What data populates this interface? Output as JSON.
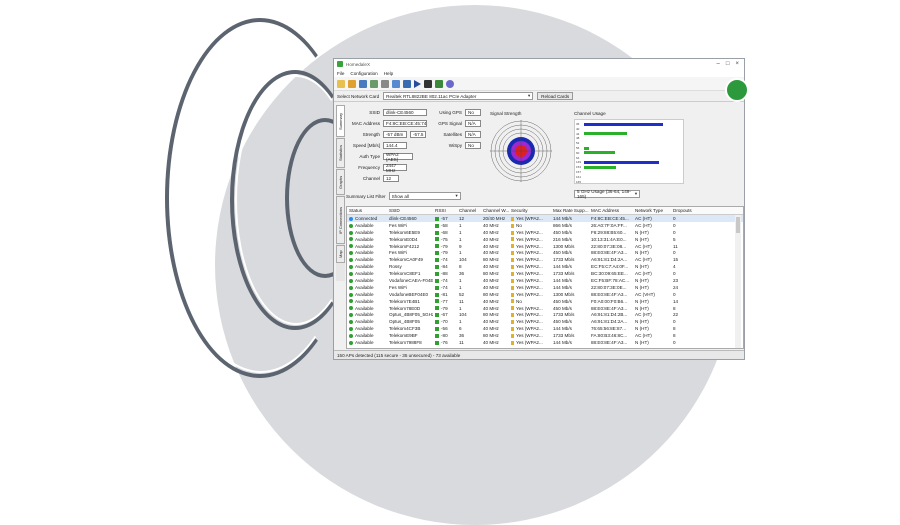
{
  "app": {
    "title": "HomedaleX",
    "window_buttons": [
      "–",
      "□",
      "×"
    ]
  },
  "menu": [
    "File",
    "Configuration",
    "Help"
  ],
  "network_card": {
    "label": "Select Network Card",
    "value": "Realtek RTL8822BE 802.11ac PCIe Adapter",
    "reload": "Reload Cards"
  },
  "tabs": [
    "Summary",
    "Statistics",
    "Graphs",
    "IP Connections",
    "Map"
  ],
  "summary": {
    "ssid": {
      "label": "SSID",
      "value": "dlink-CE4560"
    },
    "mac": {
      "label": "MAC Address",
      "value": "F4:8C:EB:CE:45:74"
    },
    "strength": {
      "label": "Strength",
      "value": "-57 dBm",
      "value2": "-57.5"
    },
    "speed": {
      "label": "Speed [Mb/s]",
      "value": "144.4"
    },
    "auth": {
      "label": "Auth Type",
      "value": "WPA2 (AES)"
    },
    "frequency": {
      "label": "Frequency",
      "value": "2447 MHz"
    },
    "channel": {
      "label": "Channel",
      "value": "12"
    },
    "using_gps": {
      "label": "Using GPS",
      "value": "No"
    },
    "gps_signal": {
      "label": "GPS Signal",
      "value": "N/A"
    },
    "satellites": {
      "label": "Satellites",
      "value": "N/A"
    },
    "wispy": {
      "label": "WiSpy",
      "value": "No"
    },
    "filter_label": "Summary List Filter",
    "filter_value": "Show all"
  },
  "signal_strength_label": "Signal Strength",
  "channel_usage": {
    "label": "Channel Usage",
    "select": "5 GHz Usage (36-64, 149-165)",
    "bars": [
      {
        "label": "36",
        "color": "#1f2fc8",
        "value": 0.82
      },
      {
        "label": "40",
        "color": "#1f2fc8",
        "value": 0.0
      },
      {
        "label": "44",
        "color": "#2ab02a",
        "value": 0.45
      },
      {
        "label": "48",
        "color": "#1f2fc8",
        "value": 0.0
      },
      {
        "label": "52",
        "color": "#1f2fc8",
        "value": 0.0
      },
      {
        "label": "56",
        "color": "#2ab02a",
        "value": 0.05
      },
      {
        "label": "60",
        "color": "#2ab02a",
        "value": 0.32
      },
      {
        "label": "64",
        "color": "#1f2fc8",
        "value": 0.0
      },
      {
        "label": "149",
        "color": "#1f2fc8",
        "value": 0.78
      },
      {
        "label": "153",
        "color": "#2ab02a",
        "value": 0.33
      },
      {
        "label": "157",
        "color": "#1f2fc8",
        "value": 0.0
      },
      {
        "label": "161",
        "color": "#1f2fc8",
        "value": 0.0
      },
      {
        "label": "165",
        "color": "#1f2fc8",
        "value": 0.0
      }
    ]
  },
  "table": {
    "headers": [
      "Status",
      "SSID",
      "RSSI",
      "Channel",
      "Channel W...",
      "Security",
      "Max Rate Supp...",
      "MAC Address",
      "Network Type",
      "Dropouts"
    ],
    "rows": [
      [
        "Connected",
        "dlink-CE4560",
        "-57",
        "12",
        "20/40 MHz",
        "Yes (WPA2...",
        "144 Mb/s",
        "F4:8C:EB:CE:45...",
        "AC (HT)",
        "0"
      ],
      [
        "Available",
        "Fes WiFi",
        "-58",
        "1",
        "40 MHz",
        "No",
        "866 Mb/s",
        "26:A0:7F:0A:FF...",
        "AC (HT)",
        "0"
      ],
      [
        "Available",
        "Telekom6E5E9",
        "-68",
        "1",
        "40 MHz",
        "Yes (WPA2...",
        "450 Mb/s",
        "F6:29:88:B5:60...",
        "N (HT)",
        "0"
      ],
      [
        "Available",
        "TelekomE0D4",
        "-75",
        "1",
        "40 MHz",
        "Yes (WPA2...",
        "216 Mb/s",
        "10:13:31:4A:E0...",
        "N (HT)",
        "5"
      ],
      [
        "Available",
        "TelekomF4212",
        "-79",
        "9",
        "40 MHz",
        "Yes (WPA2...",
        "1300 Mb/s",
        "22:80:07:3E:08...",
        "AC (HT)",
        "11"
      ],
      [
        "Available",
        "Fes WiFi",
        "-79",
        "1",
        "40 MHz",
        "Yes (WPA2...",
        "450 Mb/s",
        "88:E0:8E:4F:A3...",
        "N (HT)",
        "0"
      ],
      [
        "Available",
        "TelekomCA0F49",
        "-74",
        "104",
        "80 MHz",
        "Yes (WPA2...",
        "1733 Mb/s",
        "A6:91:81:D4:2A...",
        "AC (HT)",
        "15"
      ],
      [
        "Available",
        "Rossy",
        "-84",
        "8",
        "40 MHz",
        "Yes (WPA2...",
        "144 Mb/s",
        "EC:F5:C7:A4:0F...",
        "N (HT)",
        "4"
      ],
      [
        "Available",
        "TelekomC8EF1",
        "-88",
        "36",
        "80 MHz",
        "Yes (WPA2...",
        "1733 Mb/s",
        "BC:30:09:65:EE...",
        "AC (HT)",
        "0"
      ],
      [
        "Available",
        "VodafoneCAEA-F04E0",
        "-74",
        "1",
        "40 MHz",
        "Yes (WPA2...",
        "144 Mb/s",
        "EC:F5:BF:78:AC...",
        "N (HT)",
        "23"
      ],
      [
        "Available",
        "Fes WiFi",
        "-74",
        "1",
        "40 MHz",
        "Yes (WPA2...",
        "144 Mb/s",
        "22:80:07:3E:0E...",
        "N (HT)",
        "24"
      ],
      [
        "Available",
        "VodafoneBEF04E0",
        "-81",
        "52",
        "80 MHz",
        "Yes (WPA2...",
        "1300 Mb/s",
        "88:E0:8E:4F:A3...",
        "AC (VHT)",
        "0"
      ],
      [
        "Available",
        "Telekom7E4B1",
        "-77",
        "11",
        "40 MHz",
        "No",
        "450 Mb/s",
        "F0:A0:00:F0:B6...",
        "N (HT)",
        "14"
      ],
      [
        "Available",
        "Telekom78E0D",
        "-79",
        "1",
        "40 MHz",
        "Yes (WPA2...",
        "450 Mb/s",
        "88:E0:8E:4F:A3...",
        "N (HT)",
        "8"
      ],
      [
        "Available",
        "Optus_4B8F05_5GHz",
        "-67",
        "104",
        "80 MHz",
        "Yes (WPA2...",
        "1733 Mb/s",
        "A6:91:81:D4:2B...",
        "AC (HT)",
        "22"
      ],
      [
        "Available",
        "Optus_4B8F05",
        "-70",
        "1",
        "40 MHz",
        "Yes (WPA2...",
        "450 Mb/s",
        "A6:91:81:D4:2A...",
        "N (HT)",
        "0"
      ],
      [
        "Available",
        "Telekom4CF3B",
        "-56",
        "6",
        "40 MHz",
        "Yes (WPA2...",
        "144 Mb/s",
        "76:65:56:8E:87...",
        "N (HT)",
        "8"
      ],
      [
        "Available",
        "TelekomE9BF",
        "-80",
        "36",
        "80 MHz",
        "Yes (WPA2...",
        "1733 Mb/s",
        "FA:80:B3:46:8C...",
        "AC (HT)",
        "8"
      ],
      [
        "Available",
        "Telekom7988F8",
        "-76",
        "11",
        "40 MHz",
        "Yes (WPA2...",
        "144 Mb/s",
        "88:E0:8E:4F:A3...",
        "N (HT)",
        "0"
      ]
    ]
  },
  "status_bar": "150 APs detected (115 secure - 35 unsecured) - 73 available",
  "colors": {
    "connected": "#2a8af0",
    "available": "#30a030"
  }
}
